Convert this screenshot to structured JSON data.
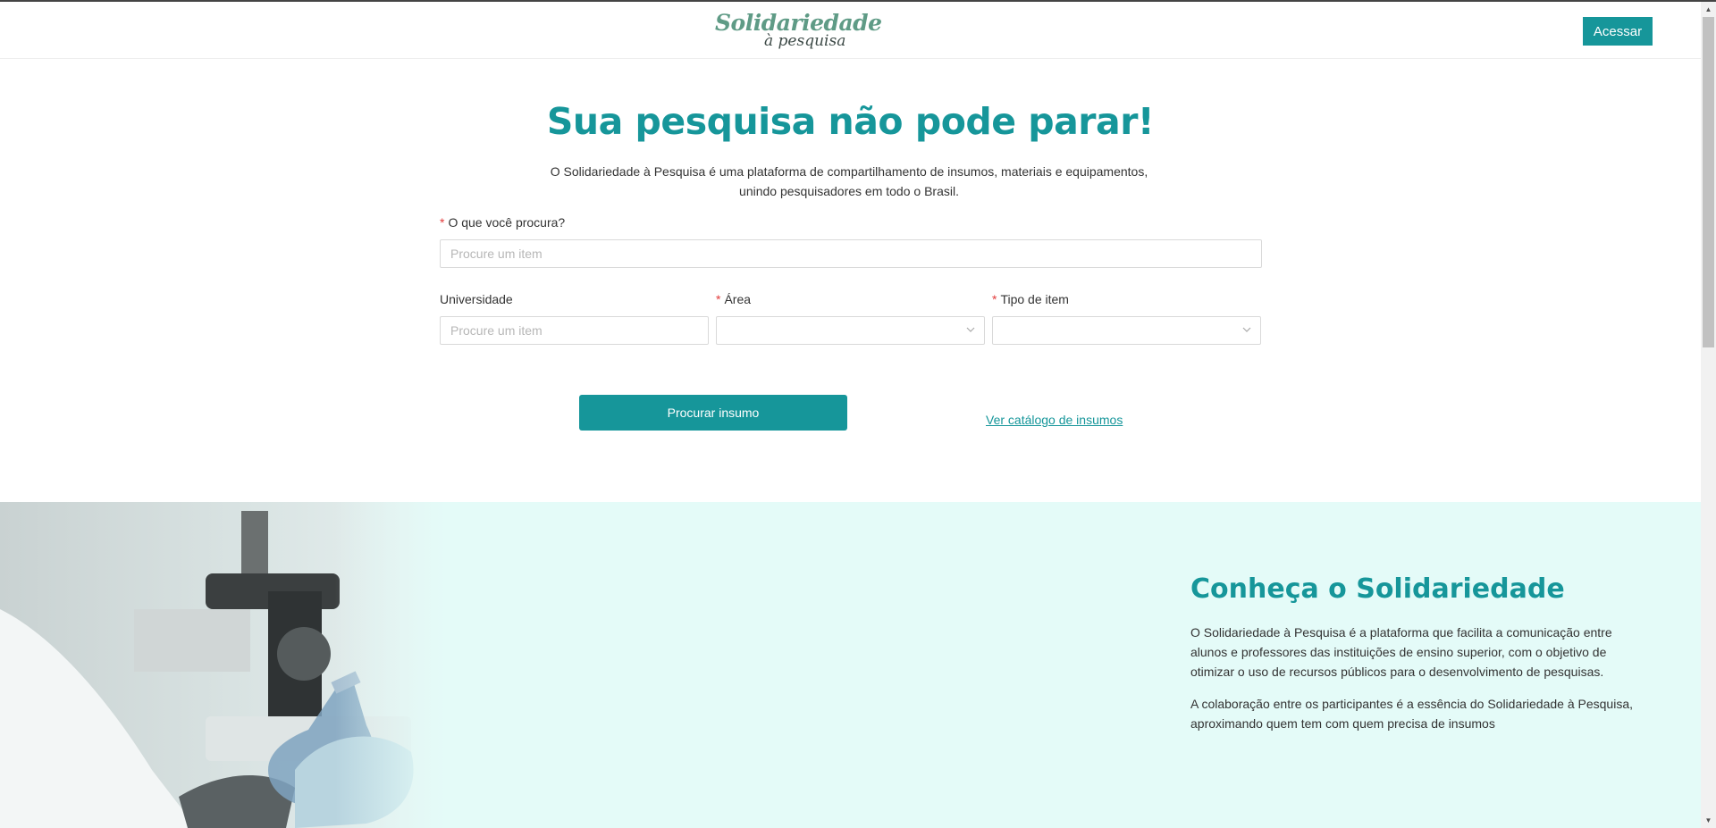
{
  "header": {
    "logo_main": "Solidariedade",
    "logo_sub": "à pesquisa",
    "login_label": "Acessar"
  },
  "hero": {
    "title": "Sua pesquisa não pode parar!",
    "desc_line1": "O Solidariedade à Pesquisa é uma plataforma de compartilhamento de insumos, materiais e equipamentos,",
    "desc_line2": "unindo pesquisadores em todo o Brasil."
  },
  "form": {
    "required_mark": "*",
    "query_label": "O que você procura?",
    "query_placeholder": "Procure um item",
    "university_label": "Universidade",
    "university_placeholder": "Procure um item",
    "area_label": "Área",
    "area_value": "",
    "type_label": "Tipo de item",
    "type_value": "",
    "search_button": "Procurar insumo",
    "catalog_link": "Ver catálogo de insumos"
  },
  "about": {
    "title": "Conheça o Solidariedade",
    "paragraph1": "O Solidariedade à Pesquisa é a plataforma que facilita a comunicação entre alunos e professores das instituições de ensino superior, com o objetivo de otimizar o uso de recursos públicos para o desenvolvimento de pesquisas.",
    "paragraph2": "A colaboração entre os participantes é a essência do Solidariedade à Pesquisa, aproximando quem tem com quem precisa de insumos"
  },
  "colors": {
    "accent": "#16969a",
    "about_bg": "#e4fbf8",
    "required": "#e23b3b"
  },
  "icons": [
    "heart-handshake-logo-icon",
    "chevron-down-icon",
    "scroll-up-icon",
    "scroll-down-icon"
  ]
}
